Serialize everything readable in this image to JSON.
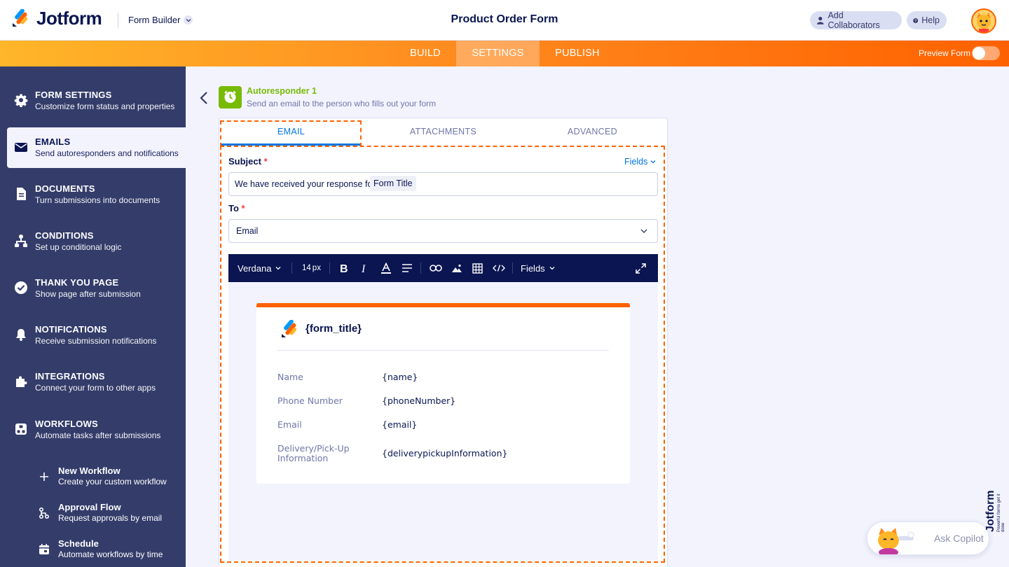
{
  "header": {
    "logo_text": "Jotform",
    "builder_label": "Form Builder",
    "page_title": "Product Order Form",
    "add_collaborators": "Add Collaborators",
    "help": "Help"
  },
  "nav": {
    "tabs": [
      "BUILD",
      "SETTINGS",
      "PUBLISH"
    ],
    "active_tab": "SETTINGS",
    "preview_label": "Preview Form",
    "preview_enabled": false
  },
  "sidebar": {
    "items": [
      {
        "title": "FORM SETTINGS",
        "desc": "Customize form status and properties"
      },
      {
        "title": "EMAILS",
        "desc": "Send autoresponders and notifications"
      },
      {
        "title": "DOCUMENTS",
        "desc": "Turn submissions into documents"
      },
      {
        "title": "CONDITIONS",
        "desc": "Set up conditional logic"
      },
      {
        "title": "THANK YOU PAGE",
        "desc": "Show page after submission"
      },
      {
        "title": "NOTIFICATIONS",
        "desc": "Receive submission notifications"
      },
      {
        "title": "INTEGRATIONS",
        "desc": "Connect your form to other apps"
      },
      {
        "title": "WORKFLOWS",
        "desc": "Automate tasks after submissions"
      }
    ],
    "sub_items": [
      {
        "title": "New Workflow",
        "desc": "Create your custom workflow"
      },
      {
        "title": "Approval Flow",
        "desc": "Request approvals by email"
      },
      {
        "title": "Schedule",
        "desc": "Automate workflows by time"
      }
    ]
  },
  "autoresponder": {
    "title": "Autoresponder 1",
    "desc": "Send an email to the person who fills out your form"
  },
  "tabs": [
    "EMAIL",
    "ATTACHMENTS",
    "ADVANCED"
  ],
  "form": {
    "subject_label": "Subject",
    "required_mark": "*",
    "fields_link": "Fields",
    "subject_text": "We have received your response for",
    "subject_tag": "Form Title",
    "to_label": "To",
    "to_value": "Email"
  },
  "toolbar": {
    "font": "Verdana",
    "size": "14",
    "size_unit": "px",
    "fields": "Fields"
  },
  "email_card": {
    "title": "{form_title}",
    "rows": [
      {
        "label": "Name",
        "value": "{name}"
      },
      {
        "label": "Phone Number",
        "value": "{phoneNumber}"
      },
      {
        "label": "Email",
        "value": "{email}"
      },
      {
        "label": "Delivery/Pick-Up Information",
        "value": "{deliverypickupInformation}"
      }
    ]
  },
  "copilot": {
    "label": "Ask Copilot",
    "brand": "Jotform",
    "tagline": "Powerful forms get it done"
  },
  "colors": {
    "accent_orange": "#ff6100",
    "accent_blue": "#0075e3",
    "navy": "#0a1551",
    "sidebar": "#343c6a",
    "green": "#78bb07"
  }
}
